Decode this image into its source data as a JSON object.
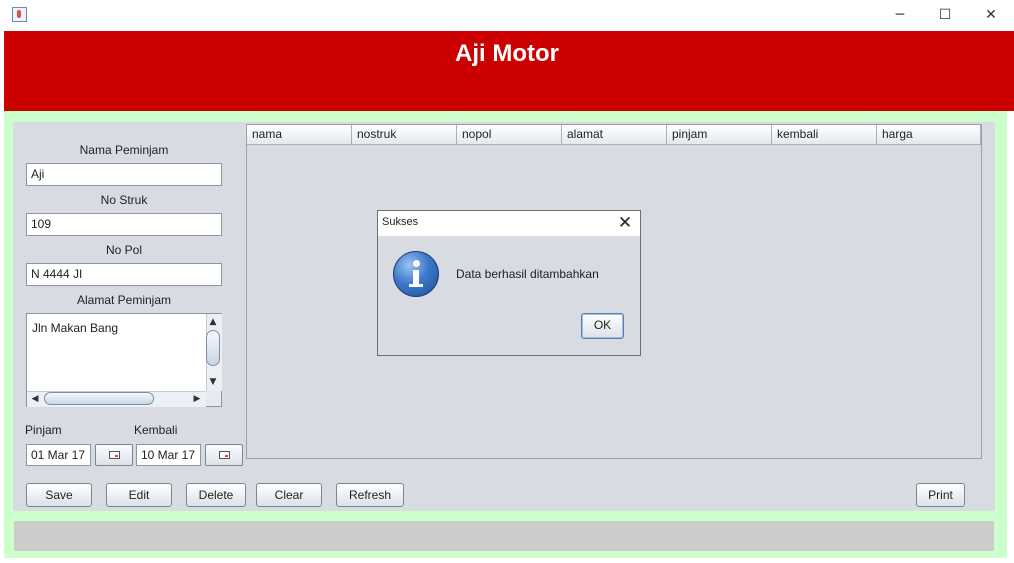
{
  "window": {
    "controls": {
      "minimize": "─",
      "maximize": "☐",
      "close": "✕"
    }
  },
  "header": {
    "title": "Aji Motor",
    "color": "#cc0000"
  },
  "form": {
    "nama_label": "Nama Peminjam",
    "nama_value": "Aji",
    "struk_label": "No Struk",
    "struk_value": "109",
    "nopol_label": "No Pol",
    "nopol_value": "N 4444 JI",
    "alamat_label": "Alamat Peminjam",
    "alamat_value": "Jln Makan Bang",
    "pinjam_label": "Pinjam",
    "pinjam_value": "01 Mar 17",
    "kembali_label": "Kembali",
    "kembali_value": "10 Mar 17"
  },
  "table": {
    "columns": [
      "nama",
      "nostruk",
      "nopol",
      "alamat",
      "pinjam",
      "kembali",
      "harga"
    ],
    "rows": []
  },
  "buttons": {
    "save": "Save",
    "edit": "Edit",
    "delete": "Delete",
    "clear": "Clear",
    "refresh": "Refresh",
    "print": "Print"
  },
  "dialog": {
    "title": "Sukses",
    "close": "✕",
    "message": "Data berhasil ditambahkan",
    "ok": "OK",
    "icon": "info-icon"
  },
  "colors": {
    "frame_green": "#ccffcc",
    "panel_grey": "#d8dbe2"
  }
}
